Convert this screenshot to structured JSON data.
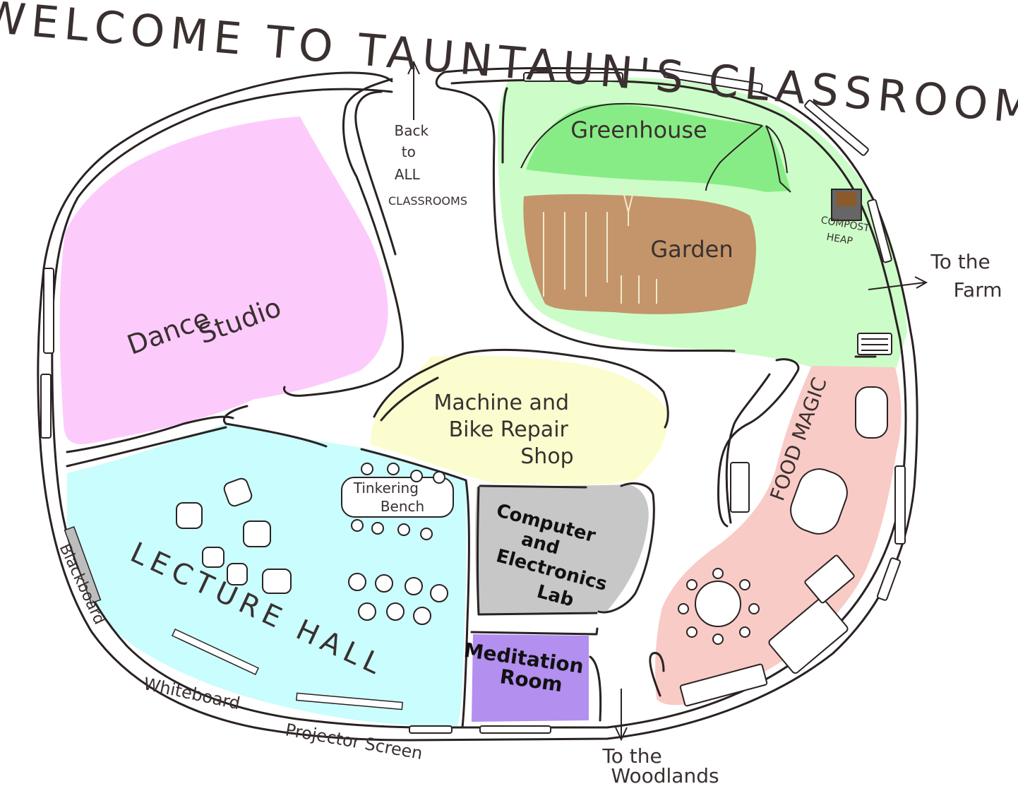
{
  "title": "WELCOME TO TAUNTAUN'S CLASSROOM",
  "colors": {
    "dance_studio": "#fccbfb",
    "greenhouse_area": "#ccfdc8",
    "greenhouse_tent": "#88ec86",
    "garden": "#c4956a",
    "machine_shop": "#fcfdcf",
    "food_magic": "#f9cbc6",
    "lecture_hall": "#cafdfd",
    "computer_lab": "#c7c7c7",
    "meditation_room": "#b38ff0"
  },
  "rooms": {
    "dance_studio": {
      "line1": "Dance",
      "line2": "Studio"
    },
    "greenhouse": "Greenhouse",
    "garden": "Garden",
    "compost": {
      "line1": "COMPOST",
      "line2": "HEAP"
    },
    "machine_shop": {
      "line1": "Machine and",
      "line2": "Bike Repair",
      "line3": "Shop"
    },
    "food_magic": "FOOD MAGIC",
    "lecture_hall": "LECTURE HALL",
    "tinkering_bench": {
      "line1": "Tinkering",
      "line2": "Bench"
    },
    "computer_lab": {
      "line1": "Computer",
      "line2": "and",
      "line3": "Electronics",
      "line4": "Lab"
    },
    "meditation_room": {
      "line1": "Meditation",
      "line2": "Room"
    }
  },
  "labels": {
    "back": {
      "line1": "Back",
      "line2": "to",
      "line3": "ALL",
      "line4": "CLASSROOMS"
    },
    "farm": {
      "line1": "To the",
      "line2": "Farm"
    },
    "woodlands": {
      "line1": "To the",
      "line2": "Woodlands"
    },
    "blackboard": "Blackboard",
    "whiteboard": "Whiteboard",
    "projector_screen": "Projector Screen"
  }
}
